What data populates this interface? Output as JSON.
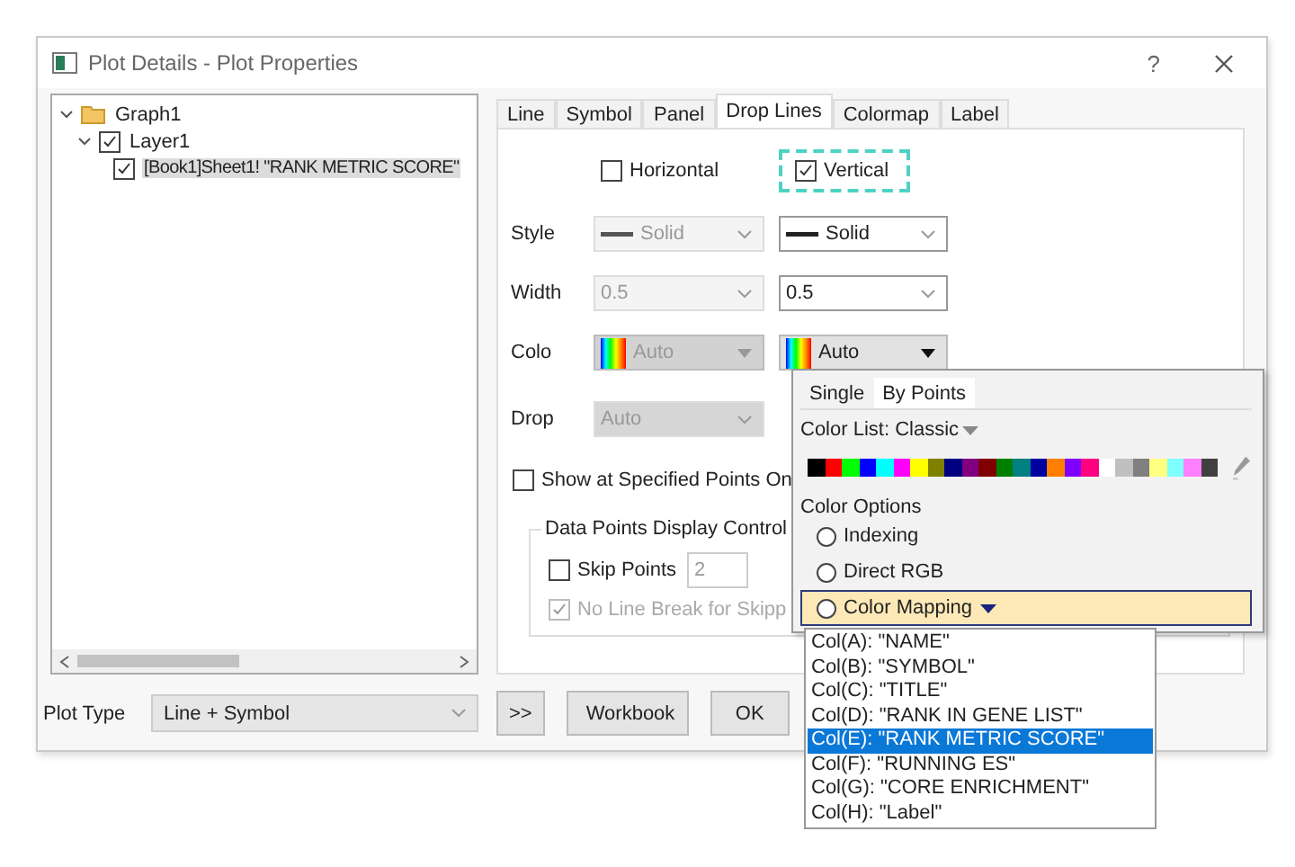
{
  "window": {
    "title": "Plot Details - Plot Properties",
    "help": "?"
  },
  "tree": [
    {
      "label": "Graph1",
      "kind": "folder",
      "expanded": true,
      "children": [
        {
          "label": "Layer1",
          "kind": "check",
          "checked": true,
          "expanded": true,
          "selected": false,
          "children": [
            {
              "label": "[Book1]Sheet1! \"RANK METRIC SCORE\"",
              "kind": "check",
              "checked": true,
              "selected": true
            }
          ]
        }
      ]
    }
  ],
  "tabs": [
    {
      "label": "Line",
      "selected": false
    },
    {
      "label": "Symbol",
      "selected": false
    },
    {
      "label": "Panel",
      "selected": false
    },
    {
      "label": "Drop Lines",
      "selected": true
    },
    {
      "label": "Colormap",
      "selected": false
    },
    {
      "label": "Label",
      "selected": false
    }
  ],
  "directions": [
    {
      "label": "Horizontal",
      "checked": false,
      "focused": false
    },
    {
      "label": "Vertical",
      "checked": true,
      "focused": true
    }
  ],
  "rows": [
    {
      "label": "Style",
      "kind": "line",
      "fields": [
        {
          "value": "Solid",
          "disabled": true
        },
        {
          "value": "Solid",
          "disabled": false
        }
      ]
    },
    {
      "label": "Width",
      "kind": "text",
      "fields": [
        {
          "value": "0.5",
          "disabled": true
        },
        {
          "value": "0.5",
          "disabled": false
        }
      ]
    },
    {
      "label": "Colo",
      "kind": "colormap",
      "fields": [
        {
          "value": "Auto",
          "disabled": true
        },
        {
          "value": "Auto",
          "disabled": false
        }
      ]
    },
    {
      "label": "Drop",
      "kind": "text",
      "fields": [
        {
          "value": "Auto",
          "disabled": true
        }
      ]
    }
  ],
  "show_specified": {
    "label": "Show at Specified Points On",
    "checked": false
  },
  "display_control": {
    "title": "Data Points Display Control",
    "skip_points": {
      "label": "Skip Points",
      "checked": false,
      "value": "2"
    },
    "no_line_break": {
      "label": "No Line Break for Skipp",
      "checked": true,
      "disabled": true
    }
  },
  "plot_type": {
    "label": "Plot Type",
    "value": "Line + Symbol"
  },
  "buttons": [
    ">>",
    "Workbook",
    "OK"
  ],
  "color_popup": {
    "tabs": [
      {
        "label": "Single",
        "selected": false
      },
      {
        "label": "By Points",
        "selected": true
      }
    ],
    "color_list": "Color List: Classic",
    "swatches": [
      {
        "color": "#000000"
      },
      {
        "color": "#ff0000"
      },
      {
        "color": "#00ff00"
      },
      {
        "color": "#0000ff"
      },
      {
        "color": "#00ffff"
      },
      {
        "color": "#ff00ff"
      },
      {
        "color": "#ffff00"
      },
      {
        "color": "#808000"
      },
      {
        "color": "#000080"
      },
      {
        "color": "#800080"
      },
      {
        "color": "#800000"
      },
      {
        "color": "#008000"
      },
      {
        "color": "#008080"
      },
      {
        "color": "#0000a0"
      },
      {
        "color": "#ff8000"
      },
      {
        "color": "#8000ff"
      },
      {
        "color": "#ff0080"
      },
      {
        "color": "#ffffff"
      },
      {
        "color": "#c0c0c0"
      },
      {
        "color": "#808080"
      },
      {
        "color": "#ffff80"
      },
      {
        "color": "#80ffff"
      },
      {
        "color": "#ff80ff"
      },
      {
        "color": "#404040"
      }
    ],
    "options_title": "Color Options",
    "options": [
      {
        "label": "Indexing",
        "selected": false,
        "highlighted": false,
        "dropdown": false
      },
      {
        "label": "Direct RGB",
        "selected": false,
        "highlighted": false,
        "dropdown": false
      },
      {
        "label": "Color Mapping",
        "selected": false,
        "highlighted": true,
        "dropdown": true
      }
    ]
  },
  "column_menu": [
    {
      "label": "Col(A): \"NAME\"",
      "selected": false
    },
    {
      "label": "Col(B): \"SYMBOL\"",
      "selected": false
    },
    {
      "label": "Col(C): \"TITLE\"",
      "selected": false
    },
    {
      "label": "Col(D): \"RANK IN GENE LIST\"",
      "selected": false
    },
    {
      "label": "Col(E): \"RANK METRIC SCORE\"",
      "selected": true
    },
    {
      "label": "Col(F): \"RUNNING ES\"",
      "selected": false
    },
    {
      "label": "Col(G): \"CORE ENRICHMENT\"",
      "selected": false
    },
    {
      "label": "Col(H): \"Label\"",
      "selected": false
    }
  ]
}
